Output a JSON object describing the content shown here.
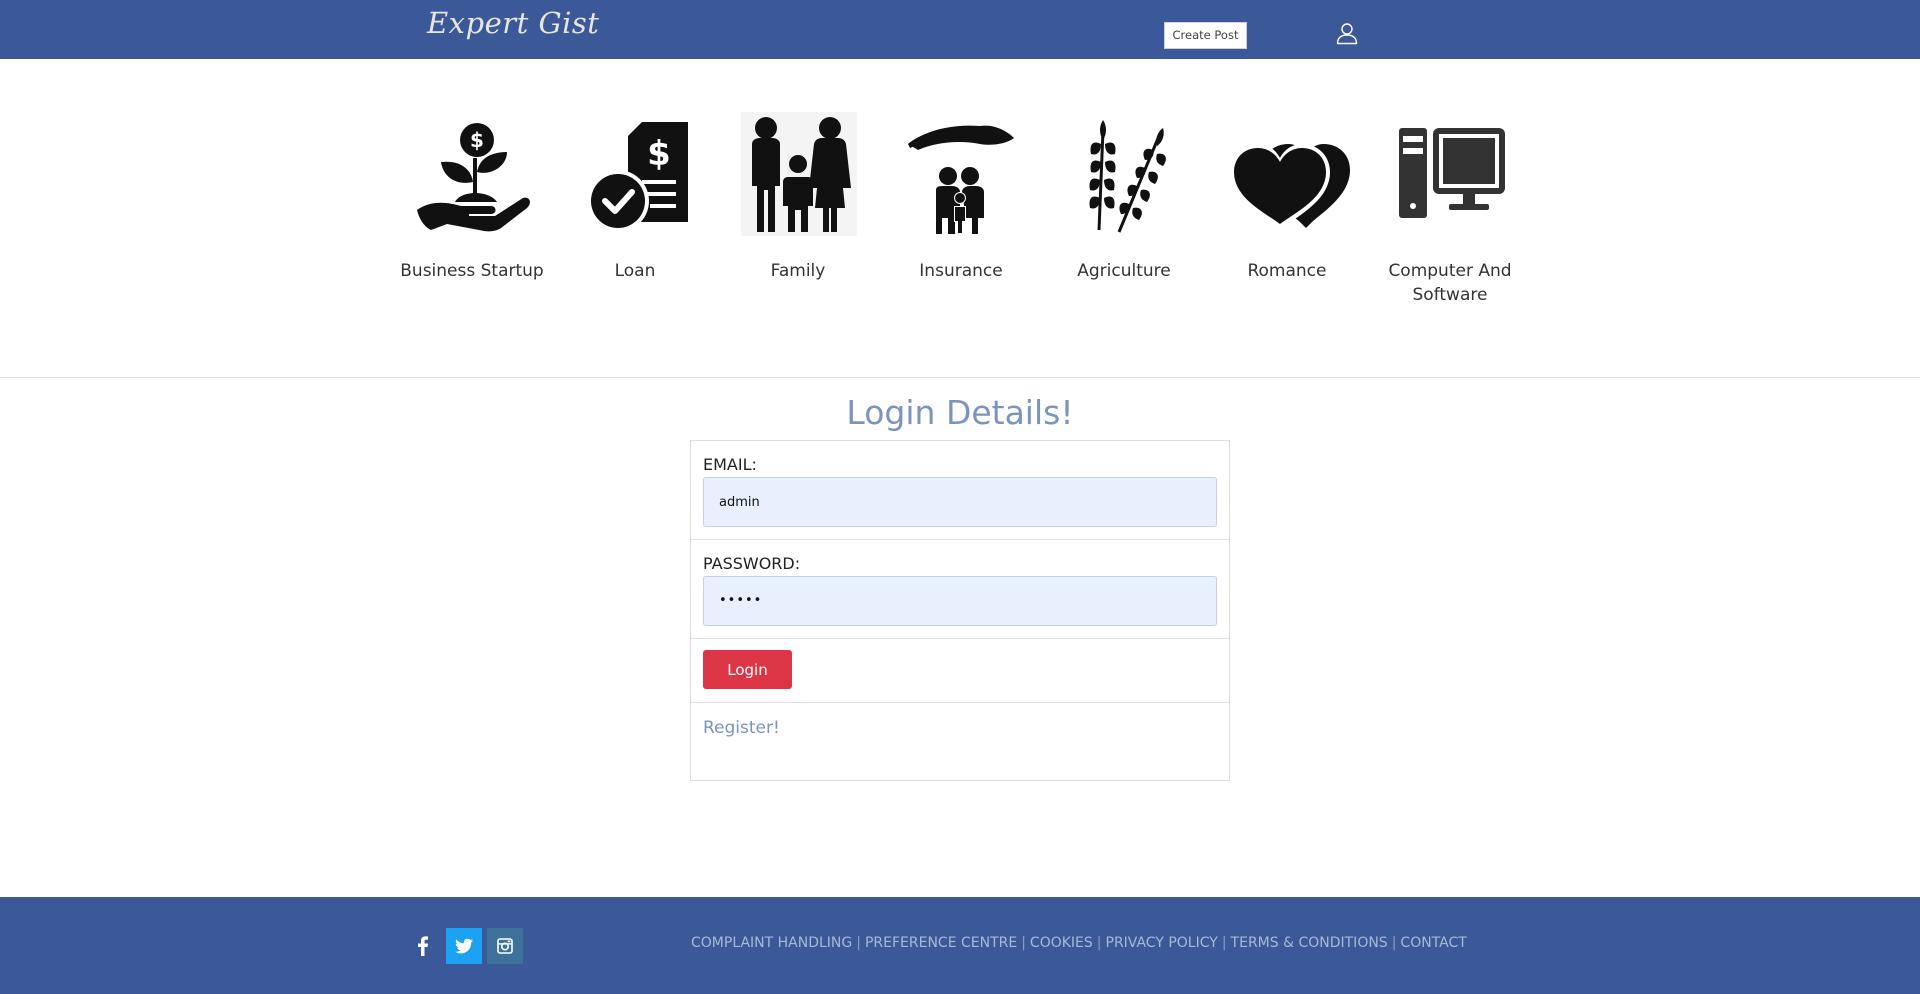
{
  "header": {
    "logo_text": "Expert Gist",
    "create_post_label": "Create Post",
    "user_icon": "user-icon"
  },
  "categories": [
    {
      "label": "Business Startup",
      "icon": "money-plant-icon"
    },
    {
      "label": "Loan",
      "icon": "loan-document-icon"
    },
    {
      "label": "Family",
      "icon": "family-icon"
    },
    {
      "label": "Insurance",
      "icon": "insurance-icon"
    },
    {
      "label": "Agriculture",
      "icon": "wheat-icon"
    },
    {
      "label": "Romance",
      "icon": "hearts-icon"
    },
    {
      "label": "Computer And Software",
      "icon": "computer-icon"
    }
  ],
  "login": {
    "title": "Login Details!",
    "email_label": "EMAIL:",
    "email_value": "admin",
    "password_label": "PASSWORD:",
    "password_value": "•••••",
    "button_label": "Login",
    "register_label": "Register!"
  },
  "footer": {
    "social": [
      "facebook-icon",
      "twitter-icon",
      "instagram-icon"
    ],
    "links": [
      "COMPLAINT HANDLING",
      "PREFERENCE CENTRE",
      "COOKIES",
      "PRIVACY POLICY",
      "TERMS & CONDITIONS",
      "CONTACT"
    ],
    "separator": "|"
  },
  "colors": {
    "brand_blue": "#3b5998",
    "accent_red": "#dc3545",
    "link_blue": "#7b94bd",
    "twitter_blue": "#1da1f2",
    "instagram_teal": "#3f729b"
  }
}
